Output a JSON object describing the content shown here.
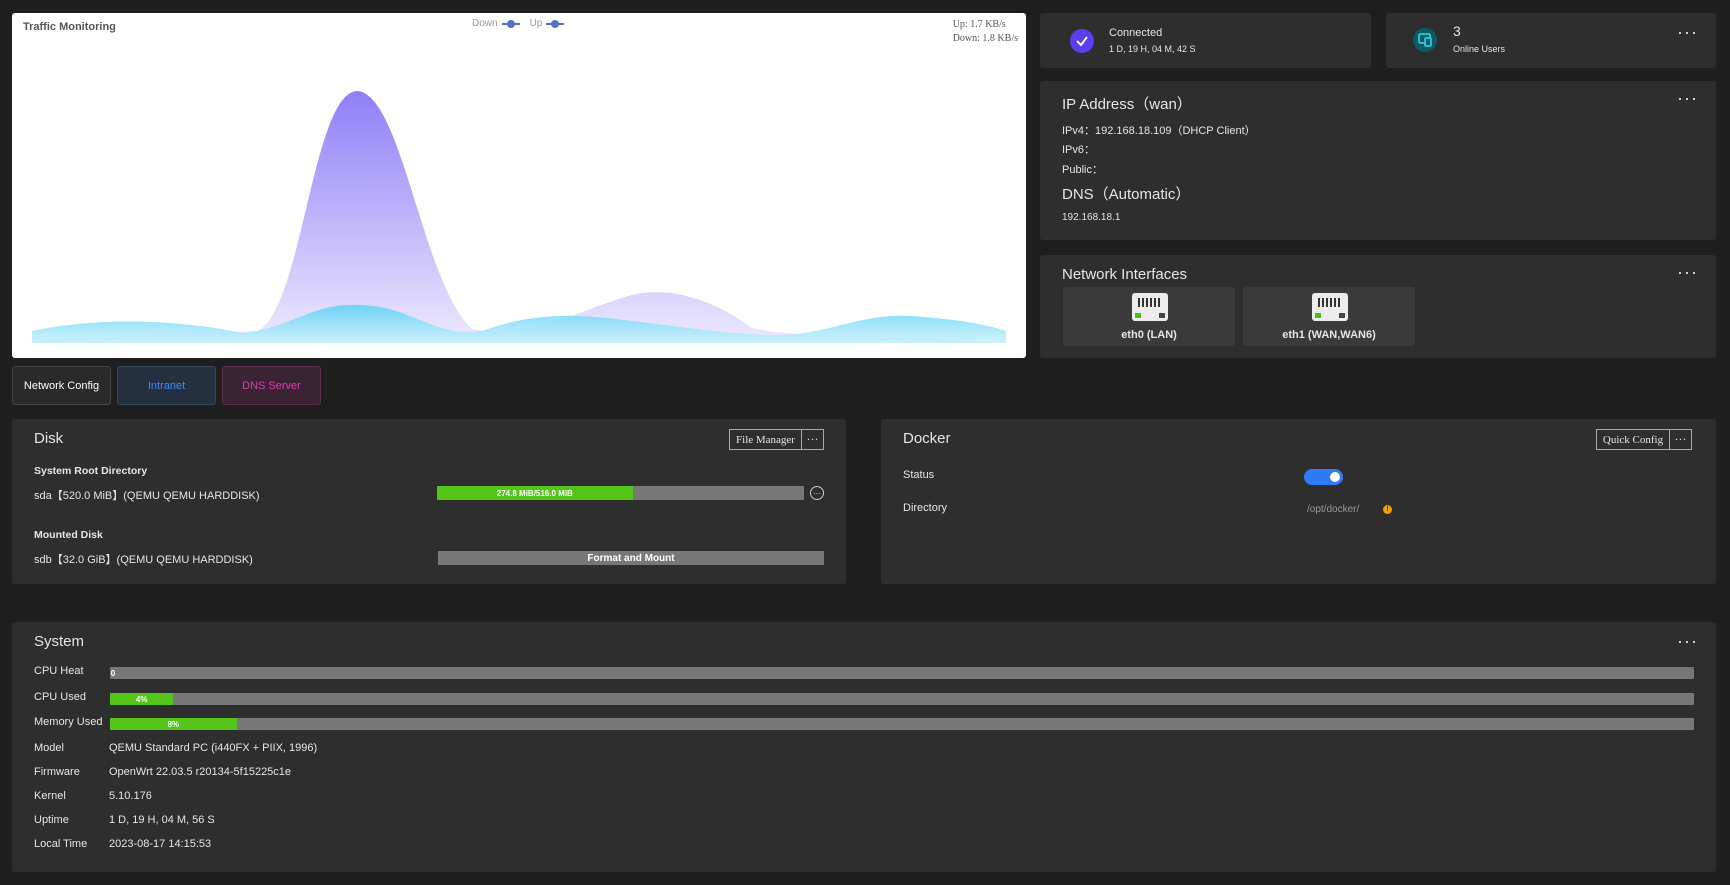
{
  "traffic": {
    "title": "Traffic Monitoring",
    "legend": {
      "down": "Down",
      "up": "Up"
    },
    "rates": {
      "up": "Up: 1.7 KB/s",
      "down": "Down: 1.8 KB/s"
    },
    "colors": {
      "down": "#8a7cf5",
      "up": "#5bd2f5"
    }
  },
  "connection": {
    "status": "Connected",
    "duration": "1 D, 19 H, 04 M, 42 S",
    "icon": "check-icon"
  },
  "online": {
    "count": "3",
    "label": "Online Users",
    "icon": "devices-icon"
  },
  "ip": {
    "title": "IP Address（wan）",
    "ipv4_label": "IPv4：",
    "ipv4_value": "192.168.18.109（DHCP Client）",
    "ipv6_label": "IPv6：",
    "public_label": "Public：",
    "dns_title": "DNS（Automatic）",
    "dns_value": "192.168.18.1"
  },
  "interfaces": {
    "title": "Network Interfaces",
    "items": [
      {
        "name": "eth0 (LAN)"
      },
      {
        "name": "eth1 (WAN,WAN6)"
      }
    ]
  },
  "tabs": [
    {
      "label": "Network Config",
      "color": "#ffffff"
    },
    {
      "label": "Intranet",
      "color": "#3b8cff"
    },
    {
      "label": "DNS Server",
      "color": "#e33ab0"
    }
  ],
  "disk": {
    "title": "Disk",
    "file_manager": "File Manager",
    "root_heading": "System Root Directory",
    "root_disk": "sda【520.0 MiB】(QEMU QEMU HARDDISK)",
    "root_usage": "274.8 MiB/516.0 MiB",
    "root_usage_fraction": 0.533,
    "mounted_heading": "Mounted Disk",
    "mounted_disk": "sdb【32.0 GiB】(QEMU QEMU HARDDISK)",
    "format_button": "Format and Mount"
  },
  "docker": {
    "title": "Docker",
    "quick_config": "Quick Config",
    "status_label": "Status",
    "status_on": true,
    "directory_label": "Directory",
    "directory_value": "/opt/docker/"
  },
  "system": {
    "title": "System",
    "cpu_heat_label": "CPU Heat",
    "cpu_heat_value": "0",
    "cpu_heat_fraction": 0,
    "cpu_used_label": "CPU Used",
    "cpu_used_value": "4%",
    "cpu_used_fraction": 0.04,
    "mem_used_label": "Memory Used",
    "mem_used_value": "8%",
    "mem_used_fraction": 0.08,
    "model_label": "Model",
    "model_value": "QEMU Standard PC (i440FX + PIIX, 1996)",
    "firmware_label": "Firmware",
    "firmware_value": "OpenWrt 22.03.5 r20134-5f15225c1e",
    "kernel_label": "Kernel",
    "kernel_value": "5.10.176",
    "uptime_label": "Uptime",
    "uptime_value": "1 D, 19 H, 04 M, 56 S",
    "localtime_label": "Local Time",
    "localtime_value": "2023-08-17 14:15:53"
  },
  "more_label": "···"
}
